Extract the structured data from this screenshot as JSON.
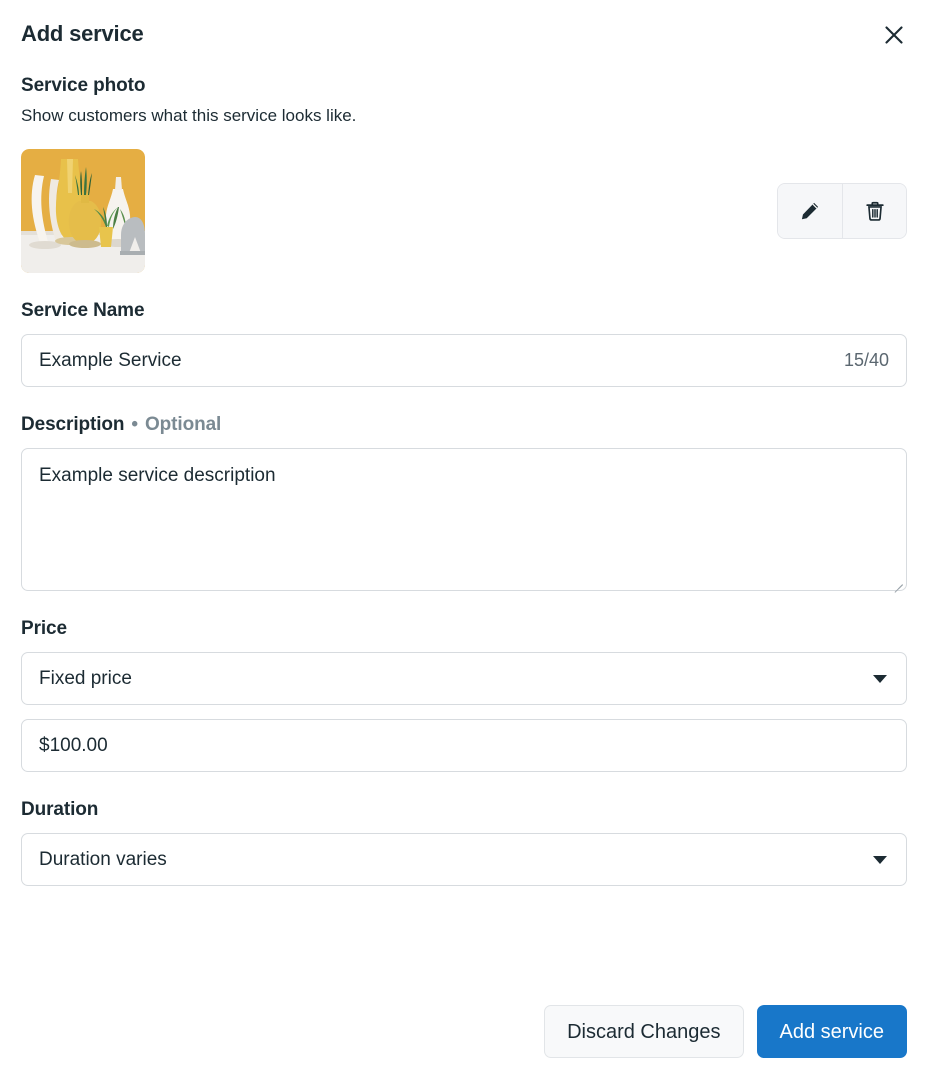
{
  "modal": {
    "title": "Add service",
    "close_icon": "close-icon"
  },
  "photo_section": {
    "heading": "Service photo",
    "description": "Show customers what this service looks like.",
    "thumbnail_alt": "service-photo-thumbnail",
    "edit_icon": "pencil-icon",
    "delete_icon": "trash-icon"
  },
  "service_name": {
    "label": "Service Name",
    "value": "Example Service",
    "placeholder": "Service Name",
    "counter": "15/40"
  },
  "description": {
    "label": "Description",
    "separator": "•",
    "optional": "Optional",
    "value": "Example service description",
    "placeholder": "Description"
  },
  "price": {
    "label": "Price",
    "type_selected": "Fixed price",
    "type_options": [
      "Fixed price"
    ],
    "amount_value": "$100.00",
    "amount_placeholder": "$0.00",
    "caret_icon": "chevron-down-icon"
  },
  "duration": {
    "label": "Duration",
    "selected": "Duration varies",
    "options": [
      "Duration varies"
    ],
    "caret_icon": "chevron-down-icon"
  },
  "footer": {
    "discard_label": "Discard Changes",
    "submit_label": "Add service"
  },
  "colors": {
    "primary": "#1877c9",
    "text": "#1c2b33",
    "muted": "#7b8a93",
    "border": "#d7dbdf",
    "surface": "#ffffff"
  }
}
